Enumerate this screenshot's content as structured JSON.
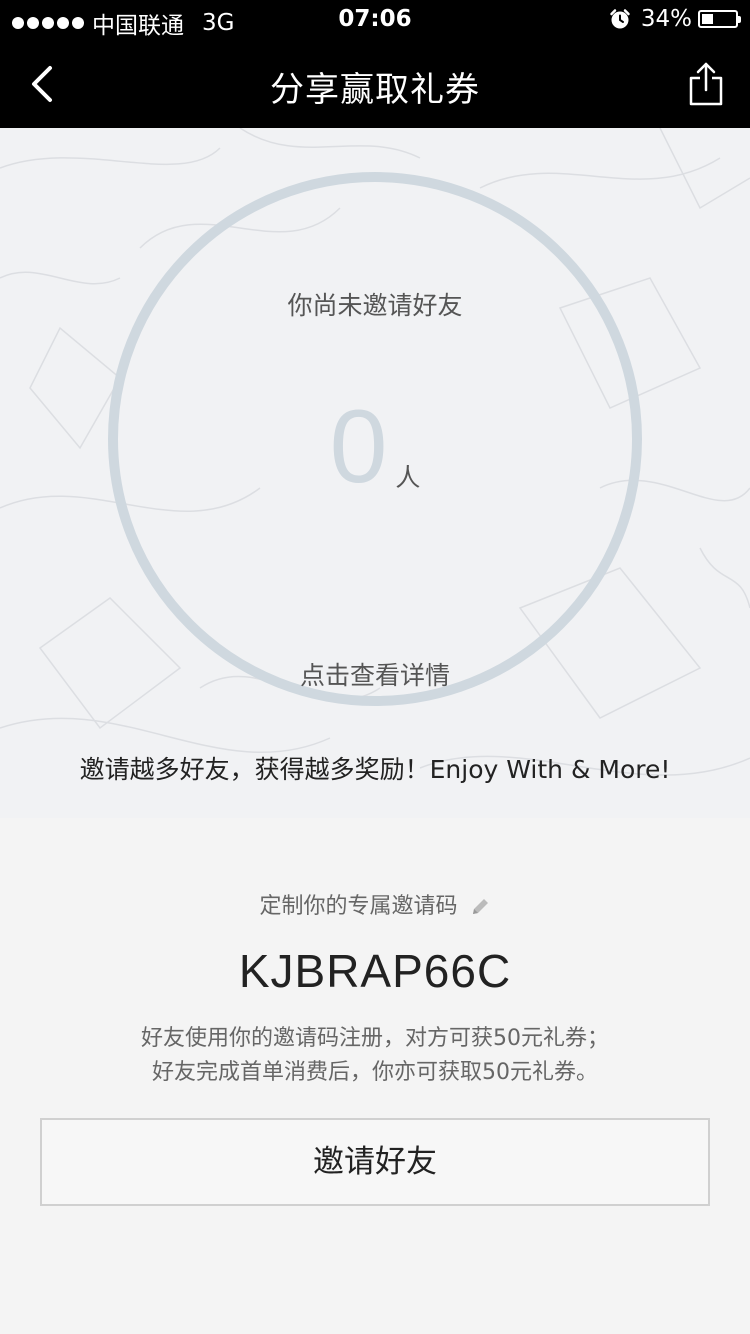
{
  "status_bar": {
    "carrier": "中国联通",
    "network": "3G",
    "time": "07:06",
    "battery_percent": "34%",
    "battery_level": 0.34,
    "signal_icon": "signal-dots-icon",
    "alarm_icon": "alarm-clock-icon",
    "battery_icon": "battery-icon"
  },
  "nav": {
    "title": "分享赢取礼券",
    "back_icon": "chevron-left-icon",
    "share_icon": "share-icon"
  },
  "hero": {
    "ring_status": "你尚未邀请好友",
    "invited_count": "0",
    "count_unit": "人",
    "detail_link": "点击查看详情",
    "tagline": "邀请越多好友，获得越多奖励！Enjoy With & More!"
  },
  "code_section": {
    "label": "定制你的专属邀请码",
    "edit_icon": "pencil-icon",
    "invite_code": "KJBRAP66C",
    "rule_1": "好友使用你的邀请码注册，对方可获50元礼券；",
    "rule_2": "好友完成首单消费后，你亦可获取50元礼券。",
    "invite_button": "邀请好友"
  },
  "colors": {
    "bar_background": "#000000",
    "hero_background": "#f1f2f4",
    "ring": "#cfd8df",
    "page_background": "#f4f4f4"
  }
}
